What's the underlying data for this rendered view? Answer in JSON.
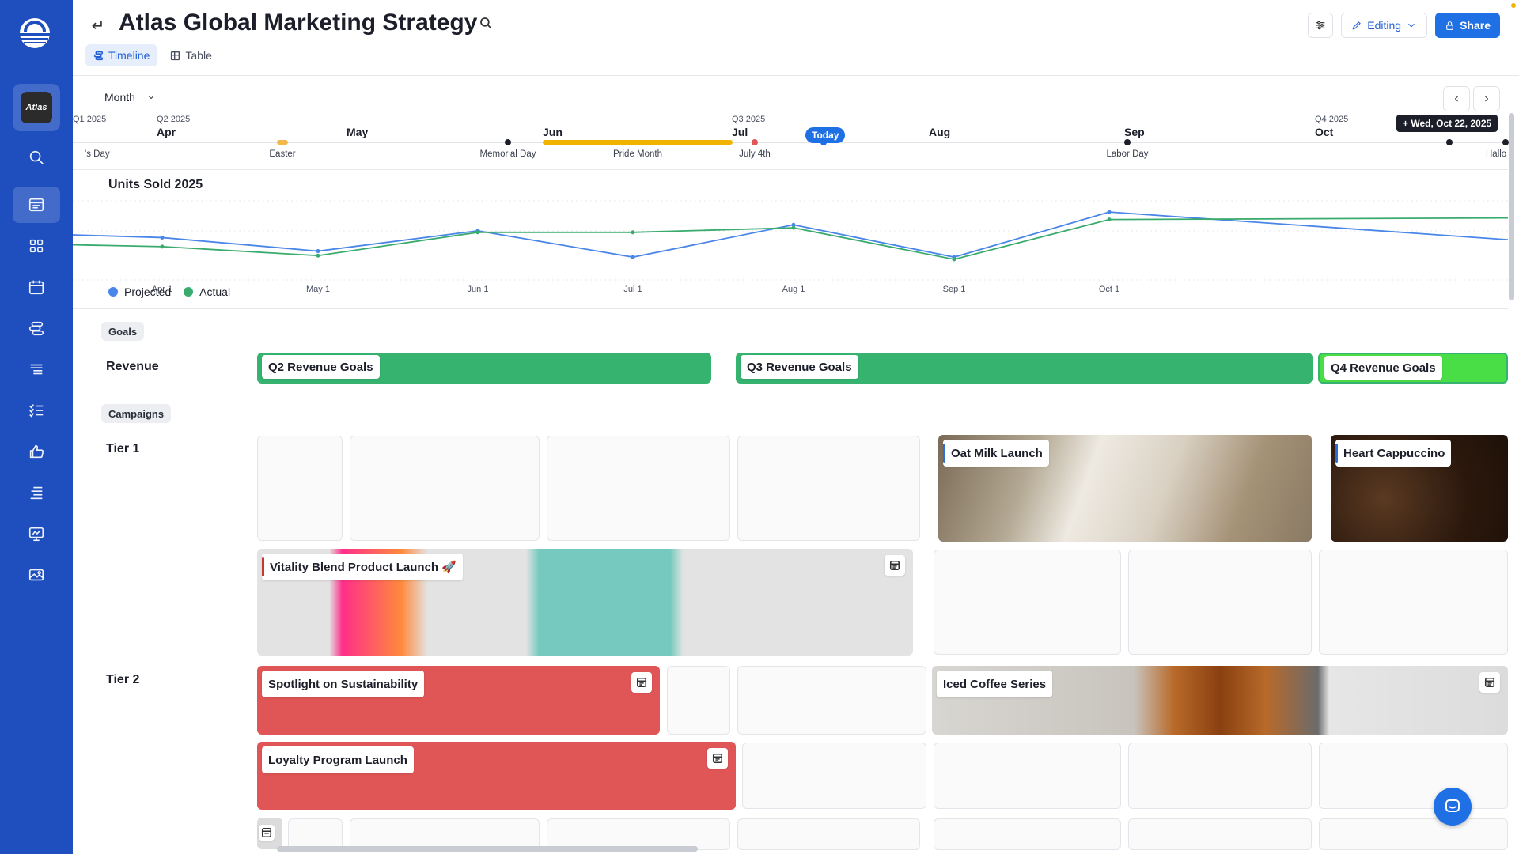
{
  "header": {
    "title": "Atlas Global Marketing Strategy",
    "tabs": [
      {
        "label": "Timeline"
      },
      {
        "label": "Table"
      }
    ],
    "editing_label": "Editing",
    "share_label": "Share"
  },
  "sidebar": {
    "workspace_logo_text": "Atlas",
    "items": [
      "search",
      "planner",
      "grid",
      "calendar",
      "timeline",
      "list",
      "checklist",
      "like",
      "align",
      "presentation",
      "gallery"
    ]
  },
  "toolbar": {
    "zoom_label": "Month"
  },
  "ruler": {
    "quarters": [
      "Q1 2025",
      "Q2 2025",
      "Q3 2025",
      "Q4 2025"
    ],
    "months": [
      "Apr",
      "May",
      "Jun",
      "Jul",
      "Aug",
      "Sep",
      "Oct"
    ],
    "events": [
      "'s Day",
      "Easter",
      "Memorial Day",
      "Pride Month",
      "July 4th",
      "Labor Day",
      "Hallo"
    ],
    "today_label": "Today",
    "hover_date": "+ Wed, Oct 22, 2025"
  },
  "chart_data": {
    "type": "line",
    "title": "Units Sold 2025",
    "x_ticks": [
      "Apr 1",
      "May 1",
      "Jun 1",
      "Jul 1",
      "Aug 1",
      "Sep 1",
      "Oct 1"
    ],
    "legend_position": "bottom-left",
    "series": [
      {
        "name": "Projected",
        "color": "#4a86e8",
        "values": [
          49,
          31,
          58,
          23,
          66,
          23,
          83
        ]
      },
      {
        "name": "Actual",
        "color": "#3aab6e",
        "values": [
          37,
          25,
          56,
          56,
          62,
          20,
          73
        ]
      }
    ]
  },
  "board": {
    "sections": [
      {
        "label": "Goals"
      },
      {
        "label": "Campaigns"
      }
    ],
    "rows": {
      "revenue": "Revenue",
      "tier1": "Tier 1",
      "tier2": "Tier 2"
    },
    "goals": [
      {
        "label": "Q2 Revenue Goals",
        "color": "#35b36f"
      },
      {
        "label": "Q3 Revenue Goals",
        "color": "#35b36f"
      },
      {
        "label": "Q4 Revenue Goals",
        "color": "#4ade46"
      }
    ],
    "campaigns": [
      {
        "label": "Oat Milk Launch",
        "accent": "#2b6fd6"
      },
      {
        "label": "Heart Cappuccino",
        "accent": "#2b6fd6"
      },
      {
        "label": "Vitality Blend Product Launch 🚀",
        "accent": "#c23a2a"
      },
      {
        "label": "Spotlight on Sustainability",
        "color": "#e05656"
      },
      {
        "label": "Iced Coffee Series"
      },
      {
        "label": "Loyalty Program Launch",
        "color": "#e05656"
      }
    ]
  }
}
